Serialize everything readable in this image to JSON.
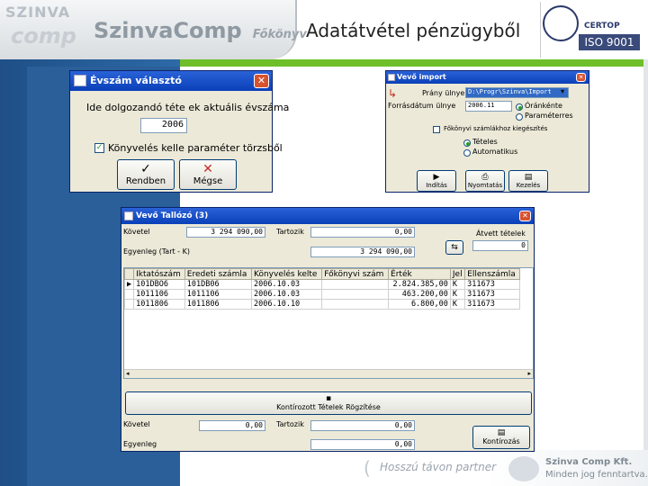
{
  "slide": {
    "logo_top": "SZINVA",
    "logo_bottom": "comp",
    "brand": "SzinvaComp",
    "brand_sub": "Főkönyv",
    "title": "Adatátvétel pénzügyből",
    "iso_certop": "CERTOP",
    "iso_text": "ISO 9001",
    "footer_tagline": "Hosszú távon partner",
    "footer_company": "Szinva Comp Kft.",
    "footer_rights": "Minden jog fenntartva."
  },
  "colors": {
    "accent_green": "#6fbf2a",
    "side_blue": "#2a5f99",
    "xp_title": "#0a3fb8"
  },
  "evszam": {
    "title": "Évszám választó",
    "prompt": "Ide dolgozandó téte ek aktuális évszáma",
    "year_value": "2006",
    "checkbox_label": "Könyvelés kelle paraméter törzsből",
    "ok_label": "Rendben",
    "cancel_label": "Mégse",
    "ok_icon": "check-icon",
    "cancel_icon": "x-icon"
  },
  "vevo_import": {
    "title": "Vevő import",
    "field1_label": "Prány ülnye",
    "field1_value": "D:\\Progr\\Szinva\\Import",
    "field2_label": "Forrásdátum ülnye",
    "field2_value": "2006.11",
    "radio1_label": "Óránkénte",
    "radio2_label": "Paraméterres",
    "check_label": "Főkönyvi számlákhoz kiegészítés",
    "radio3_label": "Tételes",
    "radio4_label": "Automatikus",
    "btn1": "Indítás",
    "btn2": "Nyomtatás",
    "btn3": "Kezelés"
  },
  "vevo_tallozo": {
    "title": "Vevő Tallózó (3)",
    "kovetel_label": "Követel",
    "kovetel_value": "3 294 090,00",
    "tartozik_label": "Tartozik",
    "tartozik_value": "0,00",
    "atvett_label": "Átvett tételek",
    "atvett_value": "0",
    "egyenleg_label": "Egyenleg (Tart - K)",
    "egyenleg_value": "3 294 090,00",
    "grid_headers": [
      "Iktatószám",
      "Eredeti számla",
      "Könyvelés kelte",
      "Főkönyvi szám",
      "Érték",
      "Jel",
      "Ellenszámla"
    ],
    "rows": [
      [
        "101DBO6",
        "101DB06",
        "2006.10.03",
        "",
        "2.824.385,00",
        "K",
        "311673"
      ],
      [
        "1011106",
        "1011106",
        "2006.10.03",
        "",
        "463.200,00",
        "K",
        "311673"
      ],
      [
        "1011806",
        "1011806",
        "2006.10.10",
        "",
        "6.800,00",
        "K",
        "311673"
      ]
    ],
    "kontrol_button": "Kontírozott Tételek Rögzítése",
    "kovetel2_label": "Követel",
    "kovetel2_value": "0,00",
    "tartozik2_label": "Tartozik",
    "tartozik2_value": "0,00",
    "egyenleg2_label": "Egyenleg",
    "egyenleg2_value": "0,00",
    "kontirozas_button": "Kontírozás"
  }
}
